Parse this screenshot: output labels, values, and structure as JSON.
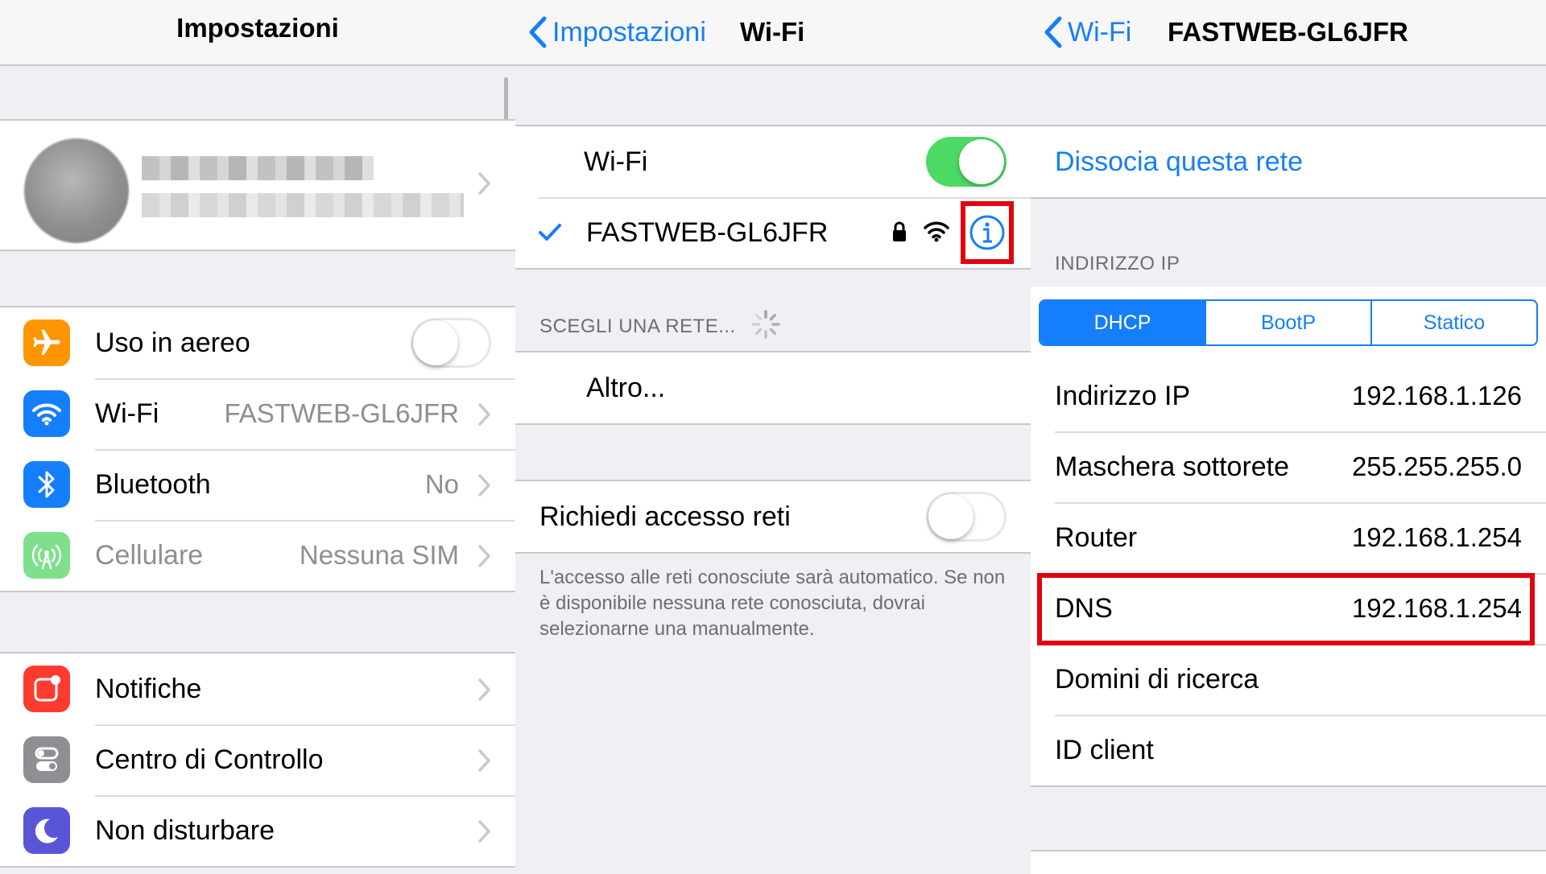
{
  "panel1": {
    "title": "Impostazioni",
    "rows_group1": [
      {
        "label": "Uso in aereo",
        "icon": "airplane-icon",
        "color": "#ff9500",
        "toggle": false
      },
      {
        "label": "Wi-Fi",
        "value": "FASTWEB-GL6JFR",
        "icon": "wifi-icon",
        "color": "#157efb"
      },
      {
        "label": "Bluetooth",
        "value": "No",
        "icon": "bluetooth-icon",
        "color": "#157efb"
      },
      {
        "label": "Cellulare",
        "value": "Nessuna SIM",
        "icon": "cellular-icon",
        "color": "#7ee08b",
        "disabled": true
      }
    ],
    "rows_group2": [
      {
        "label": "Notifiche",
        "icon": "notifications-icon",
        "color": "#ff3b30"
      },
      {
        "label": "Centro di Controllo",
        "icon": "control-center-icon",
        "color": "#8e8e93"
      },
      {
        "label": "Non disturbare",
        "icon": "moon-icon",
        "color": "#5856d6"
      }
    ]
  },
  "panel2": {
    "back_label": "Impostazioni",
    "title": "Wi-Fi",
    "wifi_label": "Wi-Fi",
    "wifi_on": true,
    "network_name": "FASTWEB-GL6JFR",
    "choose_header": "SCEGLI UNA RETE...",
    "other_label": "Altro...",
    "ask_label": "Richiedi accesso reti",
    "ask_on": false,
    "footer": "L'accesso alle reti conosciute sarà automatico. Se non è disponibile nessuna rete conosciuta, dovrai selezionarne una manualmente."
  },
  "panel3": {
    "back_label": "Wi-Fi",
    "title": "FASTWEB-GL6JFR",
    "forget_label": "Dissocia questa rete",
    "ip_header": "INDIRIZZO IP",
    "segments": [
      "DHCP",
      "BootP",
      "Statico"
    ],
    "selected_segment": "DHCP",
    "rows": [
      {
        "label": "Indirizzo IP",
        "value": "192.168.1.126"
      },
      {
        "label": "Maschera sottorete",
        "value": "255.255.255.0"
      },
      {
        "label": "Router",
        "value": "192.168.1.254"
      },
      {
        "label": "DNS",
        "value": "192.168.1.254"
      },
      {
        "label": "Domini di ricerca",
        "value": ""
      },
      {
        "label": "ID client",
        "value": ""
      }
    ]
  },
  "colors": {
    "accent": "#157efb",
    "highlight": "#e3000f",
    "toggle_on": "#4cd964"
  }
}
